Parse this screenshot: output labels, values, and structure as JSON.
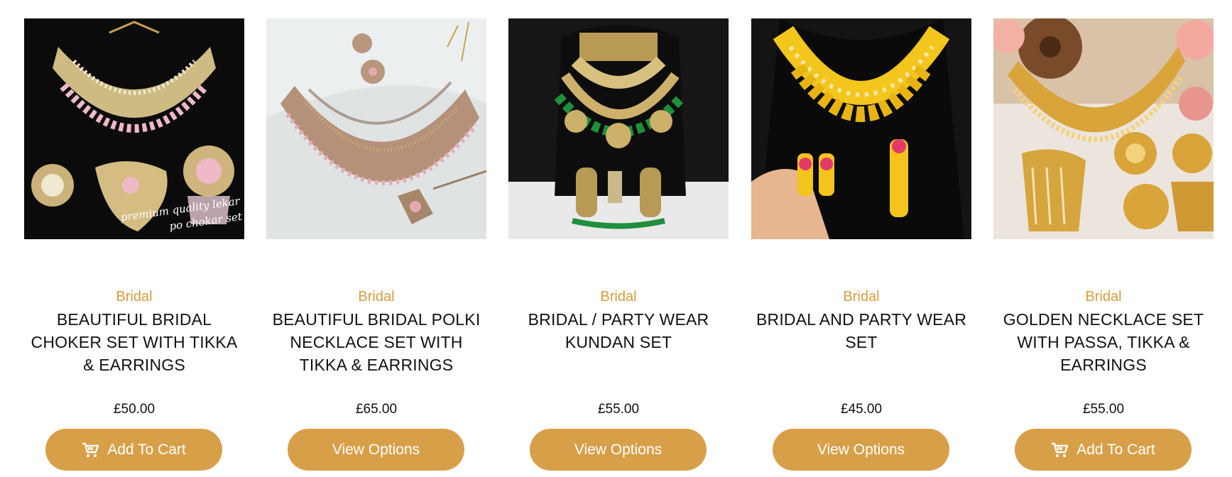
{
  "products": [
    {
      "category": "Bridal",
      "title": "BEAUTIFUL BRIDAL CHOKER SET WITH TIKKA & EARRINGS",
      "price": "£50.00",
      "button": "Add To Cart",
      "button_icon": "cart-icon",
      "image_caption": "premium quality lekar po chokar set"
    },
    {
      "category": "Bridal",
      "title": "BEAUTIFUL BRIDAL POLKI NECKLACE SET WITH TIKKA & EARRINGS",
      "price": "£65.00",
      "button": "View Options"
    },
    {
      "category": "Bridal",
      "title": "BRIDAL / PARTY WEAR KUNDAN SET",
      "price": "£55.00",
      "button": "View Options"
    },
    {
      "category": "Bridal",
      "title": "BRIDAL AND PARTY WEAR SET",
      "price": "£45.00",
      "button": "View Options"
    },
    {
      "category": "Bridal",
      "title": "GOLDEN NECKLACE SET WITH PASSA, TIKKA & EARRINGS",
      "price": "£55.00",
      "button": "Add To Cart",
      "button_icon": "cart-icon"
    }
  ],
  "colors": {
    "accent": "#d89f49",
    "category_text": "#d79c3e",
    "text": "#111111"
  }
}
